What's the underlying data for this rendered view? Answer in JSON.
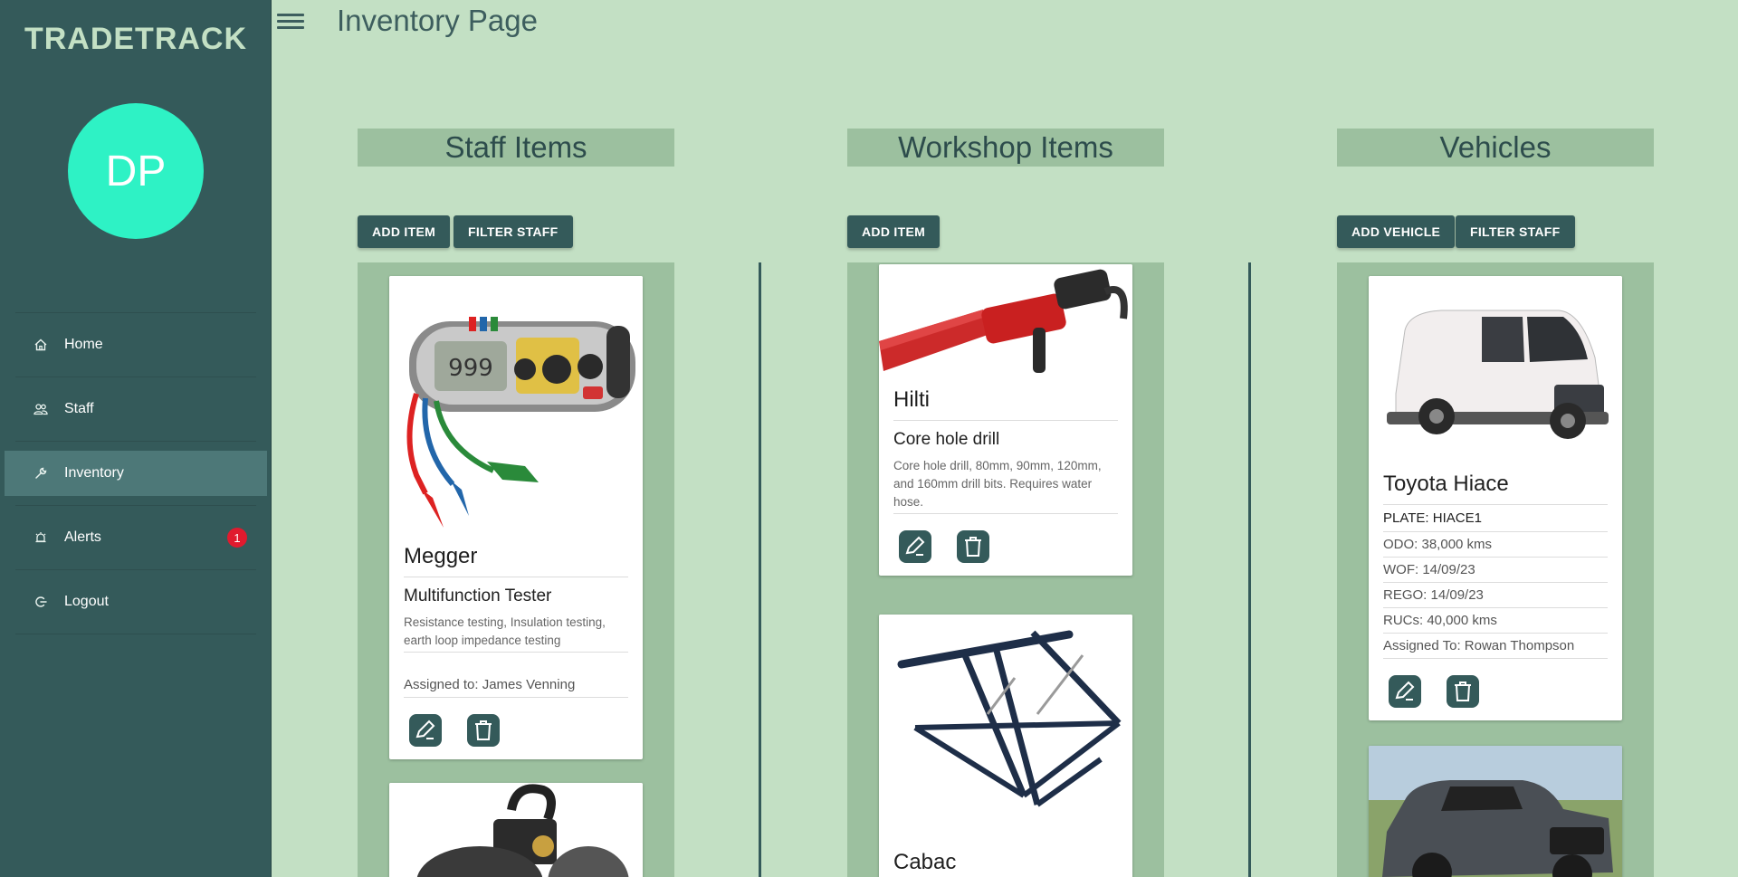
{
  "app": {
    "brand": "TRADETRACK",
    "avatar_initials": "DP"
  },
  "header": {
    "title": "Inventory Page"
  },
  "sidebar": {
    "items": [
      {
        "label": "Home",
        "icon": "home-icon"
      },
      {
        "label": "Staff",
        "icon": "people-icon"
      },
      {
        "label": "Inventory",
        "icon": "wrench-icon",
        "active": true
      },
      {
        "label": "Alerts",
        "icon": "alarm-icon",
        "badge": "1"
      },
      {
        "label": "Logout",
        "icon": "logout-icon"
      }
    ]
  },
  "columns": {
    "staff": {
      "title": "Staff Items",
      "add_label": "ADD ITEM",
      "filter_label": "FILTER STAFF",
      "cards": [
        {
          "brand": "Megger",
          "name": "Multifunction Tester",
          "description": "Resistance testing, Insulation testing, earth loop impedance testing",
          "assigned": "Assigned to: James Venning"
        }
      ]
    },
    "workshop": {
      "title": "Workshop Items",
      "add_label": "ADD ITEM",
      "cards": [
        {
          "brand": "Hilti",
          "name": "Core hole drill",
          "description": "Core hole drill, 80mm, 90mm, 120mm, and 160mm drill bits. Requires water hose."
        },
        {
          "brand": "Cabac"
        }
      ]
    },
    "vehicles": {
      "title": "Vehicles",
      "add_label": "ADD VEHICLE",
      "filter_label": "FILTER STAFF",
      "cards": [
        {
          "name": "Toyota Hiace",
          "plate": "PLATE: HIACE1",
          "odo": "ODO: 38,000 kms",
          "wof": "WOF: 14/09/23",
          "rego": "REGO: 14/09/23",
          "rucs": "RUCs: 40,000 kms",
          "assigned": "Assigned To: Rowan Thompson"
        }
      ]
    }
  },
  "colors": {
    "sidebar": "#345a5a",
    "background": "#c3e0c4",
    "panel": "#9cc09f",
    "avatar": "#2ef2c5",
    "badge": "#e01a2e"
  }
}
